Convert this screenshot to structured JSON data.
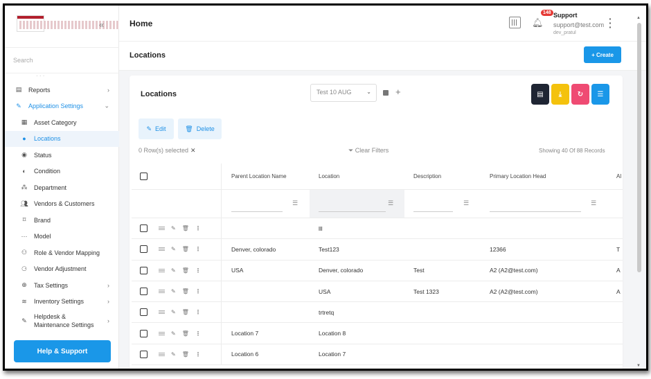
{
  "sidebar": {
    "search_placeholder": "Search",
    "items": [
      {
        "label": "Reports",
        "icon": "doc-icon",
        "level": 0,
        "chevron": "›"
      },
      {
        "label": "Application Settings",
        "icon": "wrench-icon",
        "level": 0,
        "chevron": "⌄",
        "state": "active-parent"
      },
      {
        "label": "Asset Category",
        "icon": "grid-icon",
        "level": 1
      },
      {
        "label": "Locations",
        "icon": "pin-icon",
        "level": 1,
        "state": "active"
      },
      {
        "label": "Status",
        "icon": "status-icon",
        "level": 1
      },
      {
        "label": "Condition",
        "icon": "half-circle-icon",
        "level": 1
      },
      {
        "label": "Department",
        "icon": "org-chart-icon",
        "level": 1
      },
      {
        "label": "Vendors & Customers",
        "icon": "people-icon",
        "level": 1
      },
      {
        "label": "Brand",
        "icon": "brand-icon",
        "level": 1
      },
      {
        "label": "Model",
        "icon": "dots-icon",
        "level": 1
      },
      {
        "label": "Role & Vendor Mapping",
        "icon": "user-link-icon",
        "level": 1
      },
      {
        "label": "Vendor Adjustment",
        "icon": "user-adjust-icon",
        "level": 1
      },
      {
        "label": "Tax Settings",
        "icon": "tax-icon",
        "level": 1,
        "chevron": "›"
      },
      {
        "label": "Inventory Settings",
        "icon": "inventory-icon",
        "level": 1,
        "chevron": "›"
      },
      {
        "label": "Helpdesk &\nMaintenance Settings",
        "icon": "wrench-icon",
        "level": 1,
        "chevron": "›",
        "tall": true
      }
    ],
    "help_label": "Help & Support"
  },
  "topbar": {
    "title": "Home",
    "notification_count": "148",
    "user_name": "Support",
    "user_email": "support@test.com",
    "user_role": "dev_pratul"
  },
  "page": {
    "title": "Locations",
    "create_label": "+ Create"
  },
  "card": {
    "title": "Locations",
    "view_value": "Test 10 AUG",
    "edit_label": "Edit",
    "delete_label": "Delete",
    "selected_text": "0 Row(s) selected",
    "clear_filters": "Clear Filters",
    "showing_text": "Showing 40 Of 88 Records"
  },
  "table": {
    "headers": [
      "Parent Location Name",
      "Location",
      "Description",
      "Primary Location Head",
      "Al"
    ],
    "rows": [
      [
        "",
        "lll",
        "",
        "",
        ""
      ],
      [
        "Denver, colorado",
        "Test123",
        "",
        "12366",
        "T"
      ],
      [
        "USA",
        "Denver, colorado",
        "Test",
        "A2 (A2@test.com)",
        "A"
      ],
      [
        "",
        "USA",
        "Test 1323",
        "A2 (A2@test.com)",
        "A"
      ],
      [
        "",
        "trtretq",
        "",
        "",
        ""
      ],
      [
        "Location 7",
        "Location 8",
        "",
        "",
        ""
      ],
      [
        "Location 6",
        "Location 7",
        "",
        "",
        ""
      ]
    ]
  },
  "colors": {
    "accent": "#1a97e8",
    "doc_button": "#1f2533",
    "export_button": "#f4c20d",
    "refresh_button": "#ef4b73",
    "active_bg": "#eef4fb"
  }
}
